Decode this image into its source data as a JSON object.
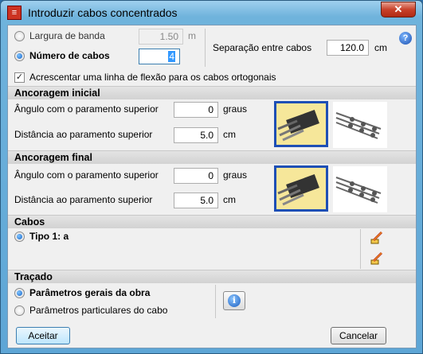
{
  "window": {
    "title": "Introduzir cabos concentrados",
    "close_glyph": "✕",
    "app_icon": "app-logo-icon"
  },
  "band": {
    "label": "Largura de banda",
    "value": "1.50",
    "unit": "m",
    "selected": false
  },
  "num_cables": {
    "label": "Número de cabos",
    "value": "4",
    "selected": true
  },
  "separation": {
    "label": "Separação entre cabos",
    "value": "120.0",
    "unit": "cm"
  },
  "help_glyph": "?",
  "bend_line": {
    "label": "Acrescentar uma linha de flexão para os cabos ortogonais",
    "checked": true,
    "glyph": "✓"
  },
  "anchor_start": {
    "title": "Ancoragem inicial",
    "angle_label": "Ângulo com o paramento superior",
    "angle_value": "0",
    "angle_unit": "graus",
    "distance_label": "Distância ao paramento superior",
    "distance_value": "5.0",
    "distance_unit": "cm"
  },
  "anchor_end": {
    "title": "Ancoragem final",
    "angle_label": "Ângulo com o paramento superior",
    "angle_value": "0",
    "angle_unit": "graus",
    "distance_label": "Distância ao paramento superior",
    "distance_value": "5.0",
    "distance_unit": "cm"
  },
  "cables": {
    "title": "Cabos",
    "item": "Tipo 1: a"
  },
  "layout": {
    "title": "Traçado",
    "option_general": "Parâmetros gerais da obra",
    "option_particular": "Parâmetros particulares do cabo",
    "info_glyph": "i"
  },
  "buttons": {
    "accept": "Aceitar",
    "cancel": "Cancelar"
  },
  "colors": {
    "selection_border": "#1e4fb5",
    "accent": "#1665c9"
  }
}
